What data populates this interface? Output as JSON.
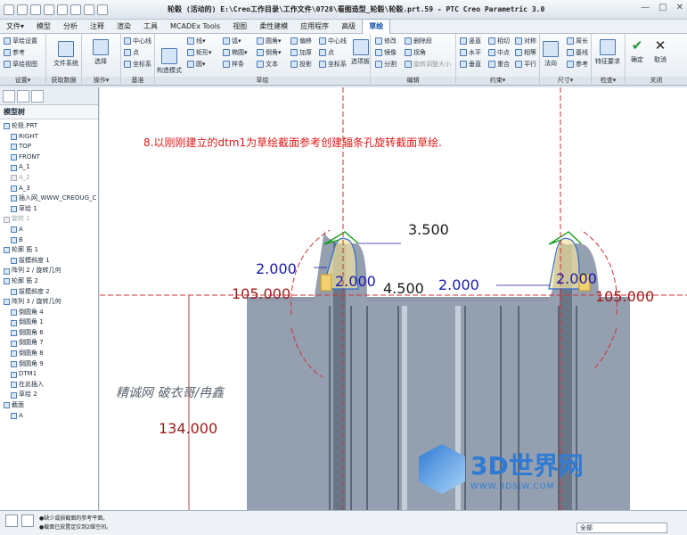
{
  "window": {
    "title": "轮毂 (活动的) E:\\Creo工作目录\\工作文件\\0728\\看图造型_轮毂\\轮毂.prt.59 - PTC Creo Parametric 3.0",
    "controls": [
      "—",
      "□",
      "✕"
    ]
  },
  "menu": {
    "items": [
      "文件▾",
      "模型",
      "分析",
      "注释",
      "渲染",
      "工具",
      "MCADEx Tools",
      "视图",
      "柔性建模",
      "应用程序",
      "高级",
      "草绘"
    ],
    "active_index": 11
  },
  "ribbon": {
    "settings": {
      "label": "设置▾",
      "items": [
        "草绘设置",
        "参考",
        "草绘视图"
      ]
    },
    "getdata": {
      "label": "获取数据",
      "items": [
        "文件系统"
      ]
    },
    "ops": {
      "label": "操作▾",
      "items": [
        "选择"
      ]
    },
    "datum": {
      "label": "基准",
      "items": [
        "中心线",
        "点",
        "坐标系"
      ]
    },
    "sketch": {
      "label": "草绘",
      "items": [
        "线▾",
        "矩形▾",
        "圆▾",
        "弧▾",
        "椭圆▾",
        "样条",
        "圆角▾",
        "倒角▾",
        "文本",
        "偏移",
        "加厚",
        "投影",
        "中心线",
        "点",
        "坐标系",
        "构造模式",
        "选项板"
      ]
    },
    "edit": {
      "label": "编辑",
      "items": [
        "修改",
        "删除段",
        "镜像",
        "拐角",
        "分割",
        "旋转调整大小"
      ]
    },
    "constraint": {
      "label": "约束▾",
      "items": [
        "竖直",
        "水平",
        "垂直",
        "相切",
        "中点",
        "重合",
        "对称",
        "相等",
        "平行"
      ]
    },
    "dimension": {
      "label": "尺寸▾",
      "items": [
        "法向",
        "周长",
        "基线",
        "参考"
      ]
    },
    "inspect": {
      "label": "检查▾",
      "items": [
        "特征要求"
      ]
    },
    "close": {
      "label": "关闭",
      "items": [
        "确定",
        "取消"
      ]
    }
  },
  "model_tree": {
    "header": "模型树",
    "items": [
      "轮毂.PRT",
      "RIGHT",
      "TOP",
      "FRONT",
      "A_1",
      "A_2",
      "A_3",
      "插入网_WWW_CREOUG_C",
      "草绘 1",
      "旋转 1",
      "A",
      "B",
      "轮廓 筋 1",
      "拔模斜度 1",
      "阵列 2 / 旋转几何",
      "轮廓 筋 2",
      "拔模斜度 2",
      "阵列 3 / 旋转几何",
      "倒圆角 4",
      "倒圆角 1",
      "倒圆角 6",
      "倒圆角 7",
      "倒圆角 8",
      "倒圆角 9",
      "DTM1",
      "在此插入",
      "草绘 2",
      "截面",
      "A"
    ],
    "greyed": [
      5,
      9
    ]
  },
  "canvas": {
    "instruction": "8.以刚刚建立的dtm1为草绘截面参考创建辐条孔旋转截面草绘.",
    "dims": [
      "3.500",
      "2.000",
      "2.000",
      "4.500",
      "2.000",
      "2.000",
      "105.000",
      "105.000",
      "134.000"
    ],
    "watermark": "精诚网 破衣哥/冉鑫",
    "brand": "3D世界网",
    "brand_url": "WWW.3DSJW.COM",
    "colors": {
      "instruction": "#e01818",
      "dim_blue": "#1a1aa8",
      "dim_red": "#a01818",
      "part": "#8a97a8"
    }
  },
  "status": {
    "messages": [
      "●缺少或损截面的参考平面。",
      "●截面已放置定位到2维空间。"
    ],
    "filter": "全部"
  }
}
